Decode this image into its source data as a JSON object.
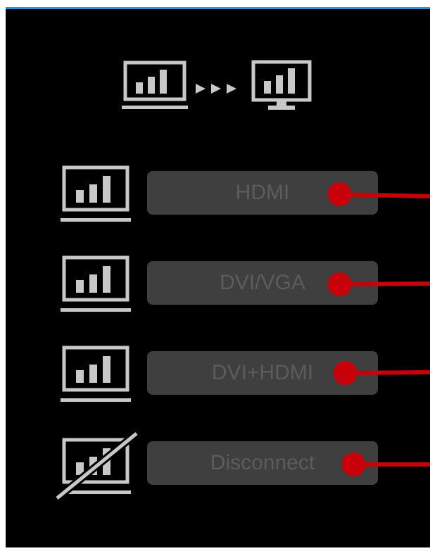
{
  "header": {
    "source_icon": "laptop-icon",
    "arrows_icon": "triple-arrow-icon",
    "target_icon": "monitor-icon"
  },
  "options": [
    {
      "label": "HDMI",
      "icon": "laptop-icon"
    },
    {
      "label": "DVI/VGA",
      "icon": "laptop-icon"
    },
    {
      "label": "DVI+HDMI",
      "icon": "laptop-icon"
    },
    {
      "label": "Disconnect",
      "icon": "laptop-disconnected-icon"
    }
  ],
  "colors": {
    "accent_bar": "#2f8fd8",
    "connector": "#c8000a",
    "button_bg": "#3f3f3f",
    "button_text": "#5c5c5c",
    "icon": "#c8c8c8"
  }
}
